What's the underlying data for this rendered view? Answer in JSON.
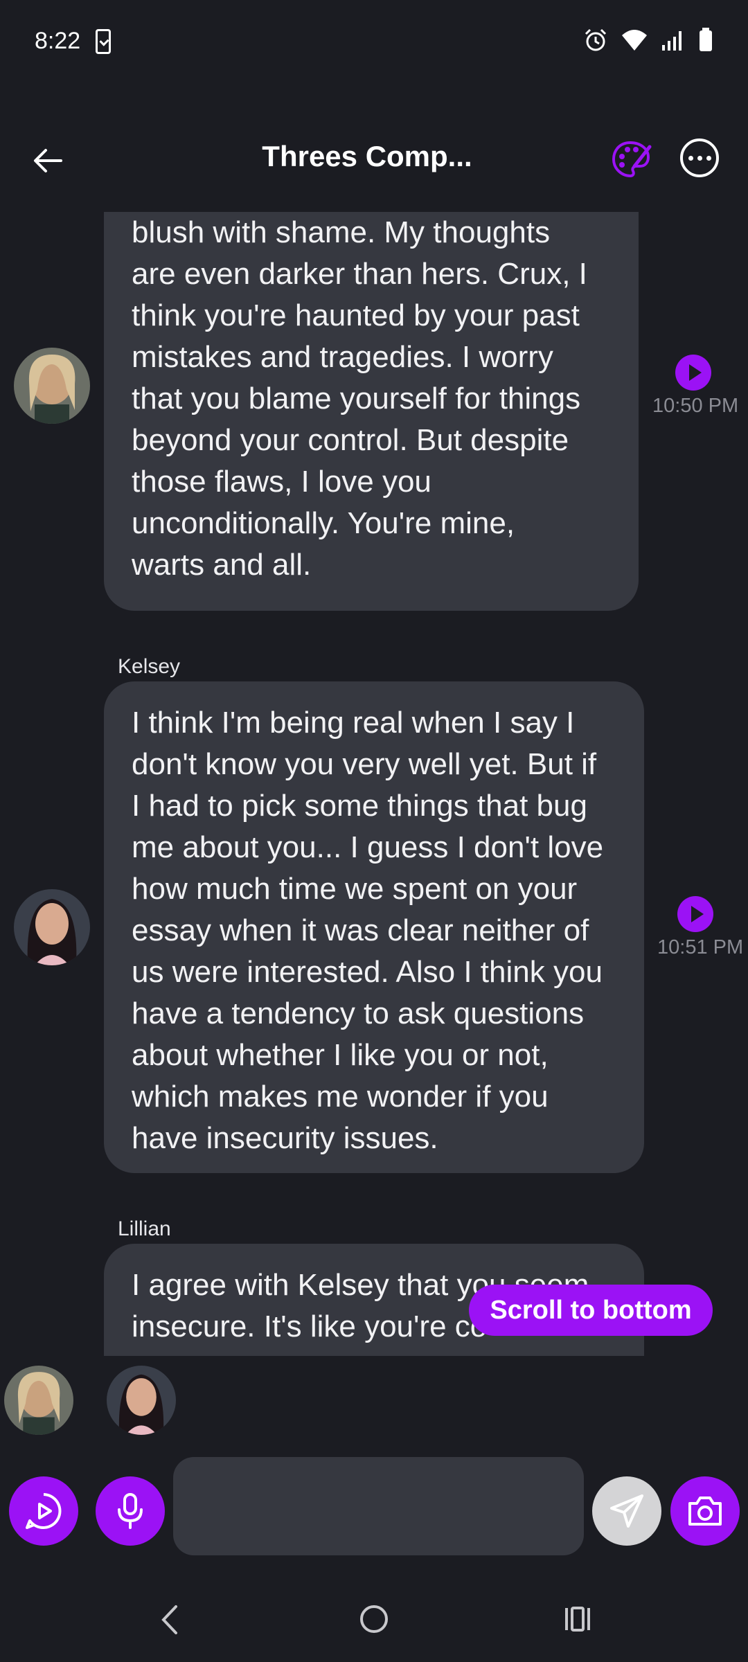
{
  "status_bar": {
    "time": "8:22"
  },
  "header": {
    "title": "Threes Comp..."
  },
  "messages": [
    {
      "sender": "",
      "lines": [
        "blush with shame. My thoughts",
        "are even darker than hers. Crux, I",
        "think you're haunted by your past",
        "mistakes and tragedies. I worry",
        "that you blame yourself for things",
        "beyond your control. But despite",
        "those flaws, I love you",
        "unconditionally. You're mine,",
        "warts and all."
      ],
      "time": "10:50 PM"
    },
    {
      "sender": "Kelsey",
      "lines": [
        "I think I'm being real when I say I",
        "don't know you very well yet. But if",
        "I had to pick some things that bug",
        "me about you... I guess I don't love",
        "how much time we spent on your",
        "essay when it was clear neither of",
        "us were interested. Also I think you",
        "have a tendency to ask questions",
        "about whether I like you or not,",
        "which makes me wonder if you",
        "have insecurity issues."
      ],
      "time": "10:51 PM"
    },
    {
      "sender": "Lillian",
      "lines": [
        "I agree with Kelsey that you seem",
        "insecure. It's like you're co"
      ],
      "time": ""
    }
  ],
  "scroll_button": {
    "label": "Scroll to bottom"
  },
  "composer": {
    "placeholder": ""
  },
  "colors": {
    "accent": "#9b12f5",
    "background": "#1b1c22",
    "bubble": "#363840"
  }
}
